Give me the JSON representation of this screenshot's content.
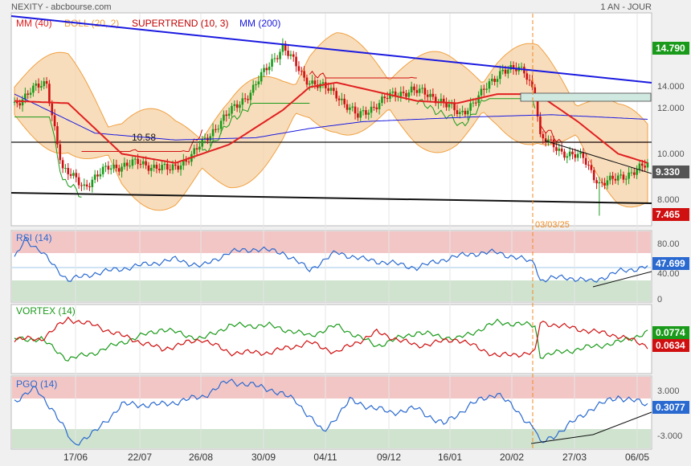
{
  "header": {
    "source": "NEXITY - abcbourse.com",
    "period": "1 AN - JOUR",
    "legend": [
      {
        "label": "MM (40)",
        "color": "#e02020"
      },
      {
        "label": "BOLL (20, 2)",
        "color": "#f0a040"
      },
      {
        "label": "SUPERTREND (10, 3)",
        "color": "#c00000"
      },
      {
        "label": "MM (200)",
        "color": "#1a1ae0"
      }
    ]
  },
  "annotations": {
    "level_label": "10.58",
    "event_date": "03/03/25"
  },
  "badges": {
    "price_high": "14.790",
    "price_last": "9.330",
    "price_low": "7.465",
    "rsi": "47.699",
    "vortex_plus": "0.0774",
    "vortex_minus": "0.0634",
    "pgo": "0.3077"
  },
  "colors": {
    "up": "#1a9a1a",
    "down": "#d01010",
    "ma40": "#e02020",
    "ma200": "#1a1ae0",
    "boll_fill": "#f5cfa0",
    "boll_line": "#f0a040",
    "trend": "#1a1ae0",
    "rsi_line": "#2a6ad0",
    "vortex_plus": "#1a9a1a",
    "vortex_minus": "#d01010",
    "overbought_zone": "#f3c6c6",
    "oversold_zone": "#cfe3cf"
  },
  "chart_data": [
    {
      "type": "candlestick",
      "title": "NEXITY",
      "x_ticks": [
        "17/06",
        "22/07",
        "26/08",
        "30/09",
        "04/11",
        "09/12",
        "16/01",
        "20/02",
        "27/03",
        "06/05"
      ],
      "y_ticks": [
        "14.000",
        "12.000",
        "10.000",
        "8.000"
      ],
      "ylim": [
        6.8,
        16.0
      ],
      "series": [
        {
          "name": "Cours",
          "anchors": [
            [
              0,
              12.0
            ],
            [
              6,
              12.7
            ],
            [
              12,
              12.9
            ],
            [
              18,
              9.2
            ],
            [
              26,
              8.5
            ],
            [
              35,
              9.3
            ],
            [
              46,
              9.5
            ],
            [
              58,
              9.2
            ],
            [
              66,
              9.8
            ],
            [
              76,
              11.2
            ],
            [
              88,
              12.6
            ],
            [
              100,
              14.6
            ],
            [
              108,
              13.2
            ],
            [
              120,
              12.5
            ],
            [
              128,
              11.5
            ],
            [
              138,
              12.3
            ],
            [
              148,
              12.7
            ],
            [
              158,
              12.3
            ],
            [
              166,
              11.6
            ],
            [
              174,
              12.5
            ],
            [
              182,
              13.6
            ],
            [
              190,
              13.5
            ],
            [
              194,
              12.6
            ],
            [
              196,
              10.6
            ],
            [
              204,
              10.0
            ],
            [
              212,
              9.7
            ],
            [
              218,
              8.6
            ],
            [
              222,
              8.7
            ],
            [
              230,
              9.1
            ],
            [
              236,
              9.4
            ]
          ]
        },
        {
          "name": "MM (40)",
          "anchors": [
            [
              0,
              12.2
            ],
            [
              20,
              12.1
            ],
            [
              40,
              9.9
            ],
            [
              60,
              9.5
            ],
            [
              80,
              10.3
            ],
            [
              100,
              11.8
            ],
            [
              110,
              12.8
            ],
            [
              120,
              13.0
            ],
            [
              135,
              12.6
            ],
            [
              150,
              12.2
            ],
            [
              165,
              12.1
            ],
            [
              180,
              12.5
            ],
            [
              195,
              12.5
            ],
            [
              210,
              11.3
            ],
            [
              225,
              9.9
            ],
            [
              236,
              9.5
            ]
          ]
        },
        {
          "name": "MM (200)",
          "anchors": [
            [
              0,
              12.5
            ],
            [
              30,
              10.8
            ],
            [
              60,
              10.5
            ],
            [
              90,
              10.6
            ],
            [
              110,
              11.0
            ],
            [
              130,
              11.3
            ],
            [
              150,
              11.4
            ],
            [
              170,
              11.5
            ],
            [
              200,
              11.6
            ],
            [
              236,
              11.4
            ]
          ]
        }
      ],
      "supertrend_levels": [
        12.0,
        9.6,
        13.2,
        12.6,
        12.8,
        10.0
      ],
      "trendlines": [
        {
          "name": "resistance",
          "from": [
            0,
            16.2
          ],
          "to": [
            236,
            13.0
          ]
        },
        {
          "name": "support",
          "from": [
            0,
            8.4
          ],
          "to": [
            236,
            7.8
          ]
        },
        {
          "name": "level",
          "from": [
            0,
            10.6
          ],
          "to": [
            236,
            10.6
          ]
        }
      ]
    },
    {
      "type": "line",
      "title": "RSI (14)",
      "y_ticks": [
        "80.00",
        "40.00",
        "0"
      ],
      "ylim": [
        0,
        100
      ],
      "zones": [
        [
          70,
          100
        ],
        [
          0,
          30
        ]
      ],
      "series": [
        {
          "name": "RSI",
          "anchors": [
            [
              0,
              60
            ],
            [
              4,
              90
            ],
            [
              10,
              70
            ],
            [
              20,
              30
            ],
            [
              30,
              40
            ],
            [
              45,
              50
            ],
            [
              60,
              60
            ],
            [
              70,
              50
            ],
            [
              80,
              70
            ],
            [
              90,
              75
            ],
            [
              100,
              70
            ],
            [
              110,
              45
            ],
            [
              120,
              70
            ],
            [
              130,
              60
            ],
            [
              140,
              55
            ],
            [
              150,
              48
            ],
            [
              160,
              60
            ],
            [
              170,
              68
            ],
            [
              180,
              70
            ],
            [
              194,
              55
            ],
            [
              196,
              30
            ],
            [
              205,
              35
            ],
            [
              215,
              28
            ],
            [
              225,
              42
            ],
            [
              236,
              50
            ]
          ]
        }
      ]
    },
    {
      "type": "line",
      "title": "VORTEX (14)",
      "ylim": [
        0.5,
        1.5
      ],
      "series": [
        {
          "name": "VI+",
          "anchors": [
            [
              0,
              1.0
            ],
            [
              10,
              1.0
            ],
            [
              20,
              0.7
            ],
            [
              30,
              0.8
            ],
            [
              40,
              0.95
            ],
            [
              55,
              1.15
            ],
            [
              70,
              1.0
            ],
            [
              80,
              1.2
            ],
            [
              95,
              1.2
            ],
            [
              110,
              1.05
            ],
            [
              120,
              1.2
            ],
            [
              135,
              0.9
            ],
            [
              150,
              1.1
            ],
            [
              165,
              1.0
            ],
            [
              180,
              1.25
            ],
            [
              194,
              1.2
            ],
            [
              196,
              0.75
            ],
            [
              210,
              0.85
            ],
            [
              225,
              0.95
            ],
            [
              236,
              1.1
            ]
          ]
        },
        {
          "name": "VI-",
          "anchors": [
            [
              0,
              1.0
            ],
            [
              10,
              1.0
            ],
            [
              20,
              1.3
            ],
            [
              30,
              1.2
            ],
            [
              40,
              1.05
            ],
            [
              55,
              0.85
            ],
            [
              70,
              1.0
            ],
            [
              80,
              0.8
            ],
            [
              95,
              0.8
            ],
            [
              110,
              0.95
            ],
            [
              120,
              0.8
            ],
            [
              135,
              1.1
            ],
            [
              150,
              0.9
            ],
            [
              165,
              1.0
            ],
            [
              180,
              0.75
            ],
            [
              194,
              0.8
            ],
            [
              196,
              1.25
            ],
            [
              210,
              1.15
            ],
            [
              225,
              1.05
            ],
            [
              236,
              0.9
            ]
          ]
        }
      ]
    },
    {
      "type": "line",
      "title": "PGO (14)",
      "y_ticks": [
        "3.000",
        "-3.000"
      ],
      "ylim": [
        -4.5,
        4.5
      ],
      "zones": [
        [
          3,
          4.5
        ],
        [
          -4.5,
          -3
        ]
      ],
      "series": [
        {
          "name": "PGO",
          "anchors": [
            [
              0,
              1.5
            ],
            [
              8,
              3.0
            ],
            [
              14,
              0.5
            ],
            [
              22,
              -4.0
            ],
            [
              30,
              -2.5
            ],
            [
              40,
              1.0
            ],
            [
              55,
              1.0
            ],
            [
              70,
              2.0
            ],
            [
              80,
              4.0
            ],
            [
              95,
              3.0
            ],
            [
              105,
              1.5
            ],
            [
              115,
              -2.5
            ],
            [
              125,
              1.5
            ],
            [
              140,
              0.0
            ],
            [
              150,
              0.5
            ],
            [
              160,
              -1.5
            ],
            [
              170,
              1.0
            ],
            [
              180,
              2.5
            ],
            [
              194,
              -2.0
            ],
            [
              196,
              -4.0
            ],
            [
              205,
              -2.0
            ],
            [
              215,
              0.5
            ],
            [
              225,
              2.0
            ],
            [
              236,
              1.0
            ]
          ]
        }
      ]
    }
  ]
}
